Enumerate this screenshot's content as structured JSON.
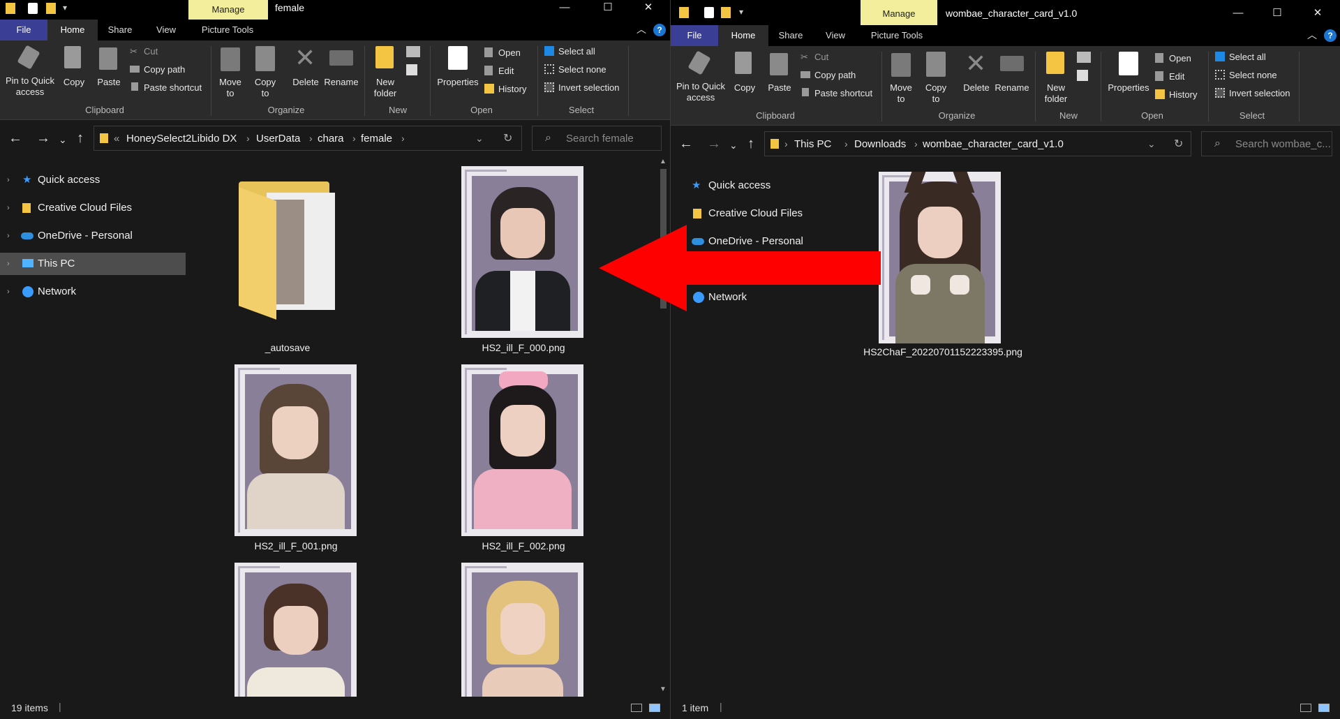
{
  "left": {
    "title": "female",
    "manage": "Manage",
    "tabs": [
      "File",
      "Home",
      "Share",
      "View",
      "Picture Tools"
    ],
    "ribbon": {
      "pin": "Pin to Quick access",
      "copy": "Copy",
      "paste": "Paste",
      "cut": "Cut",
      "copy_path": "Copy path",
      "paste_shortcut": "Paste shortcut",
      "move_to": "Move to",
      "copy_to": "Copy to",
      "delete": "Delete",
      "rename": "Rename",
      "new_folder": "New folder",
      "properties": "Properties",
      "open": "Open",
      "edit": "Edit",
      "history": "History",
      "select_all": "Select all",
      "select_none": "Select none",
      "invert_selection": "Invert selection",
      "groups": [
        "Clipboard",
        "Organize",
        "New",
        "Open",
        "Select"
      ]
    },
    "breadcrumb": [
      "«",
      "HoneySelect2Libido DX",
      "UserData",
      "chara",
      "female"
    ],
    "search_placeholder": "Search female",
    "nav": [
      "Quick access",
      "Creative Cloud Files",
      "OneDrive - Personal",
      "This PC",
      "Network"
    ],
    "files": [
      "_autosave",
      "HS2_ill_F_000.png",
      "HS2_ill_F_001.png",
      "HS2_ill_F_002.png"
    ],
    "status": "19 items"
  },
  "right": {
    "title": "wombae_character_card_v1.0",
    "manage": "Manage",
    "tabs": [
      "File",
      "Home",
      "Share",
      "View",
      "Picture Tools"
    ],
    "breadcrumb": [
      "This PC",
      "Downloads",
      "wombae_character_card_v1.0"
    ],
    "search_placeholder": "Search wombae_c...",
    "nav": [
      "Quick access",
      "Creative Cloud Files",
      "OneDrive - Personal",
      "Network"
    ],
    "files": [
      "HS2ChaF_20220701152223395.png"
    ],
    "status": "1 item"
  },
  "colors": {
    "manage_bg": "#f2ee9c",
    "file_tab": "#3a3f95",
    "arrow": "#ff0000",
    "selected_nav": "#4d4d4d"
  }
}
